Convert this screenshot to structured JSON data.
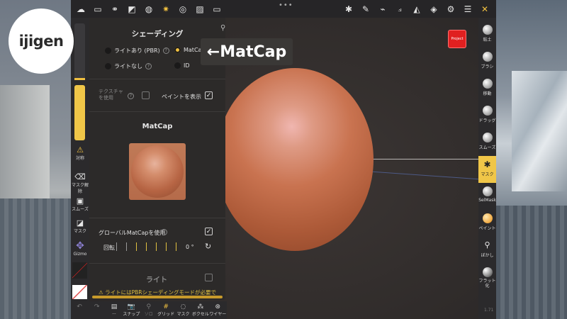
{
  "logo": {
    "text": "ijigen"
  },
  "topbar": {
    "left_icons": [
      "cloud-icon",
      "folder-icon",
      "share-icon",
      "scene-icon",
      "globe-icon",
      "sun-icon",
      "material-icon",
      "image-icon",
      "video-icon"
    ],
    "menu_dots": "•••",
    "right_icons": [
      "sculpt-icon",
      "pen-icon",
      "brush-icon",
      "tool-icon",
      "triangle-icon",
      "layers-icon",
      "settings-icon",
      "sliders-icon",
      "wrench-icon"
    ]
  },
  "left_bar": {
    "items": [
      {
        "label": "対称",
        "icon": "symmetry-icon",
        "glyph": "⚠"
      },
      {
        "label": "マスク解除",
        "icon": "eraser-icon",
        "glyph": "⌫"
      },
      {
        "label": "スムーズ",
        "icon": "smooth-icon",
        "glyph": "▣"
      },
      {
        "label": "マスク",
        "icon": "mask-icon",
        "glyph": "◪"
      },
      {
        "label": "Gizmo",
        "icon": "gizmo-icon",
        "glyph": "✥"
      }
    ]
  },
  "bottom_bar": {
    "items": [
      {
        "label": "",
        "glyph": "↶"
      },
      {
        "label": "",
        "glyph": "↷"
      },
      {
        "label": "...",
        "glyph": "▤"
      },
      {
        "label": "スナップ",
        "glyph": "📷"
      },
      {
        "label": "ソロ",
        "glyph": "⚲"
      },
      {
        "label": "グリッド",
        "glyph": "#"
      },
      {
        "label": "マスク",
        "glyph": "◌"
      },
      {
        "label": "ボクセル",
        "glyph": "⁂"
      },
      {
        "label": "ワイヤー",
        "glyph": "⊛"
      }
    ]
  },
  "panel": {
    "title": "シェーディング",
    "shading_modes": {
      "pbr": "ライトあり (PBR)",
      "matcap": "MatCap",
      "unlit": "ライトなし",
      "id": "ID"
    },
    "texture_label": "テクスチャ\nを使用",
    "show_paint_label": "ペイントを表示",
    "matcap_title": "MatCap",
    "global_matcap_label": "グローバルMatCapを使用",
    "rotation_label": "回転",
    "rotation_value": "0 °",
    "light_title": "ライト",
    "warning": "⚠ ライトにはPBRシェーディングモードが必要で"
  },
  "callout": {
    "text": "←MatCap"
  },
  "project_button": {
    "text": "Project"
  },
  "right_bar": {
    "items": [
      {
        "label": "粘土"
      },
      {
        "label": "ブラシ"
      },
      {
        "label": "移動"
      },
      {
        "label": "ドラッグ"
      },
      {
        "label": "スムーズ"
      },
      {
        "label": "マスク"
      },
      {
        "label": "SelMask"
      },
      {
        "label": "ペイント"
      },
      {
        "label": "ぼかし"
      },
      {
        "label": "フラット\n化"
      }
    ]
  },
  "version": "1.71",
  "colors": {
    "accent": "#f0c040",
    "panel": "#2c2a29",
    "bar": "#2b2a2c",
    "project": "#e02020"
  }
}
